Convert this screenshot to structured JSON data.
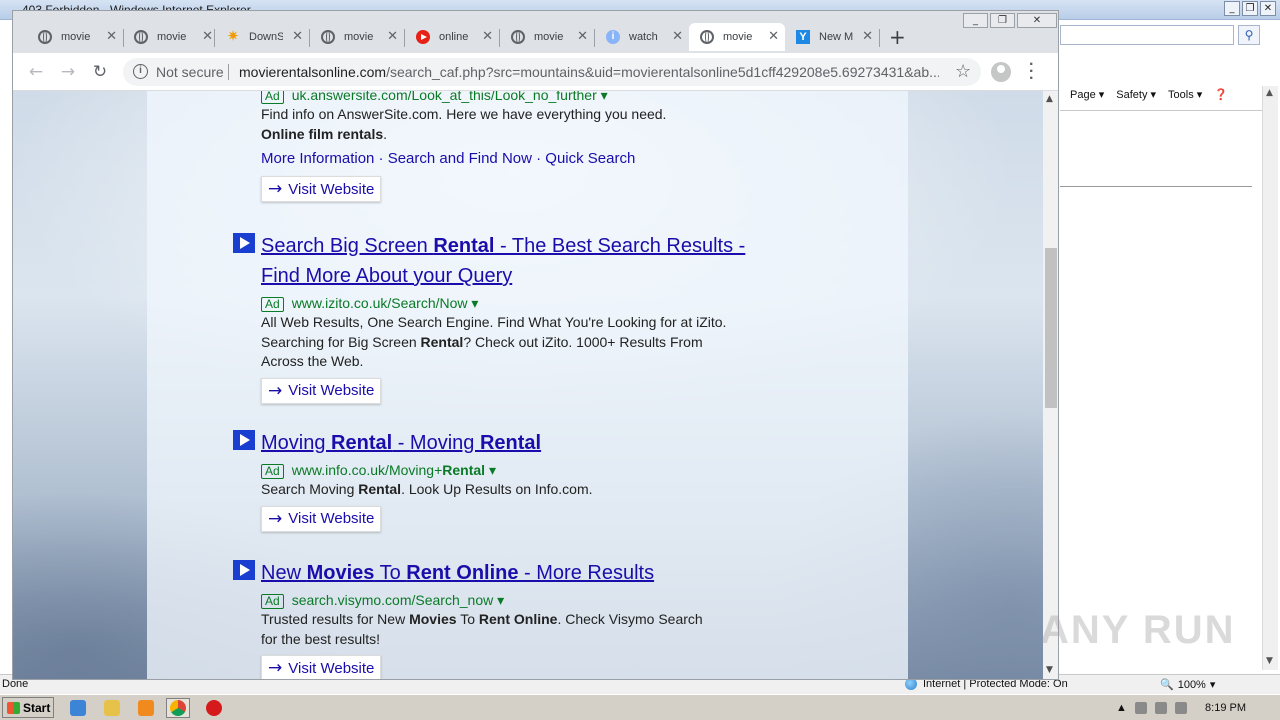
{
  "ie": {
    "title": "403 Forbidden - Windows Internet Explorer",
    "cmd": [
      "Page ▾",
      "Safety ▾",
      "Tools ▾"
    ],
    "status_left": "Done",
    "status_zone": "Internet | Protected Mode: On",
    "zoom": "100%"
  },
  "chrome": {
    "tabs": [
      {
        "label": "movie",
        "icon": "globe-icon"
      },
      {
        "label": "movie",
        "icon": "globe-icon"
      },
      {
        "label": "DownS",
        "icon": "star-icon"
      },
      {
        "label": "movie",
        "icon": "globe-icon"
      },
      {
        "label": "online",
        "icon": "youtube-icon"
      },
      {
        "label": "movie",
        "icon": "globe-icon"
      },
      {
        "label": "watch",
        "icon": "info-icon"
      },
      {
        "label": "movie",
        "icon": "globe-icon"
      },
      {
        "label": "New M",
        "icon": "yahoo-icon"
      }
    ],
    "not_secure": "Not secure",
    "url_domain": "movierentalsonline.com",
    "url_path": "/search_caf.php?src=mountains&uid=movierentalsonline5d1cff429208e5.69273431&ab..."
  },
  "results": [
    {
      "partial": true,
      "title": "",
      "ad": "Ad",
      "url": "uk.answersite.com/Look_at_this/Look_no_further ▾",
      "desc_plain": "Find info on AnswerSite.com. Here we have everything you need.",
      "desc_bold": "Online film rentals",
      "desc_tail": ".",
      "links": "More Information · Search and Find Now · Quick Search",
      "visit": "Visit Website"
    },
    {
      "title_pre": "Search Big Screen ",
      "title_bold": "Rental",
      "title_post": " - The Best Search Results - Find More About your Query",
      "ad": "Ad",
      "url": "www.izito.co.uk/Search/Now ▾",
      "desc_pre": "All Web Results, One Search Engine. Find What You're Looking for at iZito. Searching for Big Screen ",
      "desc_bold": "Rental",
      "desc_post": "? Check out iZito. 1000+ Results From Across the Web.",
      "visit": "Visit Website"
    },
    {
      "title_pre": "Moving ",
      "title_bold": "Rental",
      "title_mid": " - Moving ",
      "title_bold2": "Rental",
      "ad": "Ad",
      "url_pre": "www.info.co.uk/Moving+",
      "url_bold": "Rental",
      "url_post": " ▾",
      "desc_pre": "Search Moving ",
      "desc_bold": "Rental",
      "desc_post": ". Look Up Results on Info.com.",
      "visit": "Visit Website"
    },
    {
      "title_pre": "New ",
      "title_bold": "Movies",
      "title_mid": " To ",
      "title_bold2": "Rent Online",
      "title_post": " - More Results",
      "ad": "Ad",
      "url": "search.visymo.com/Search_now ▾",
      "desc_pre": "Trusted results for New ",
      "desc_bold": "Movies",
      "desc_mid": " To ",
      "desc_bold2": "Rent Online",
      "desc_post": ". Check Visymo Search for the best results!",
      "visit": "Visit Website"
    }
  ],
  "taskbar": {
    "start": "Start",
    "time": "8:19 PM"
  },
  "watermark": "ANY RUN"
}
